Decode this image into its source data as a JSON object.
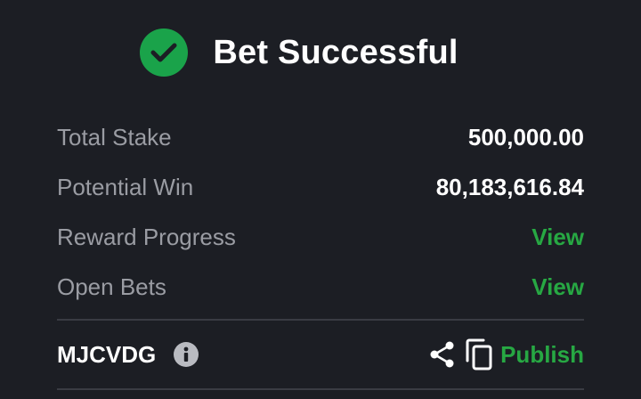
{
  "header": {
    "title": "Bet Successful",
    "status_icon": "check-circle-icon",
    "accent_color": "#1aa34a"
  },
  "summary": {
    "total_stake": {
      "label": "Total Stake",
      "value": "500,000.00"
    },
    "potential_win": {
      "label": "Potential Win",
      "value": "80,183,616.84"
    },
    "reward_progress": {
      "label": "Reward Progress",
      "link": "View"
    },
    "open_bets": {
      "label": "Open Bets",
      "link": "View"
    }
  },
  "footer": {
    "booking_code": "MJCVDG",
    "info_icon": "info-icon",
    "share_icon": "share-icon",
    "copy_icon": "copy-icon",
    "publish_label": "Publish"
  },
  "colors": {
    "background": "#1c1e24",
    "link": "#27a843",
    "label": "#9a9ca3",
    "value": "#ffffff"
  }
}
